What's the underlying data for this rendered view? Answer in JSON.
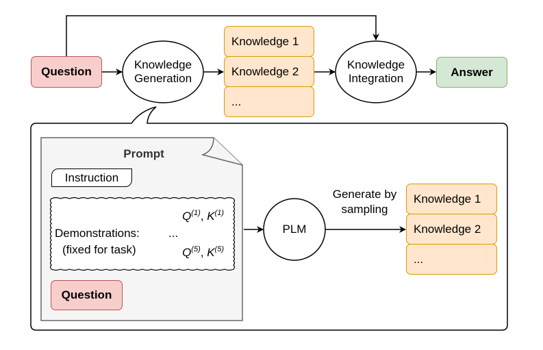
{
  "top_flow": {
    "question": "Question",
    "knowledge_generation": [
      "Knowledge",
      "Generation"
    ],
    "knowledge_items": [
      "Knowledge 1",
      "Knowledge 2",
      "..."
    ],
    "knowledge_integration": [
      "Knowledge",
      "Integration"
    ],
    "answer": "Answer"
  },
  "detail": {
    "prompt_title": "Prompt",
    "instruction": "Instruction",
    "demonstrations": {
      "label": "Demonstrations:",
      "sublabel": "(fixed for task)",
      "first": {
        "q": "Q",
        "q_sup": "(1)",
        "sep": ", ",
        "k": "K",
        "k_sup": "(1)"
      },
      "ellipsis": "...",
      "last": {
        "q": "Q",
        "q_sup": "(5)",
        "sep": ", ",
        "k": "K",
        "k_sup": "(5)"
      }
    },
    "question": "Question",
    "plm": "PLM",
    "edge_label": [
      "Generate by",
      "sampling"
    ],
    "knowledge_items": [
      "Knowledge 1",
      "Knowledge 2",
      "..."
    ]
  },
  "colors": {
    "question_fill": "#f8cecc",
    "question_stroke": "#b85450",
    "answer_fill": "#d5e8d4",
    "answer_stroke": "#82b366",
    "knowledge_fill": "#ffe6cc",
    "knowledge_stroke": "#d79b00",
    "prompt_fill": "#f5f5f5",
    "prompt_stroke": "#666666"
  }
}
